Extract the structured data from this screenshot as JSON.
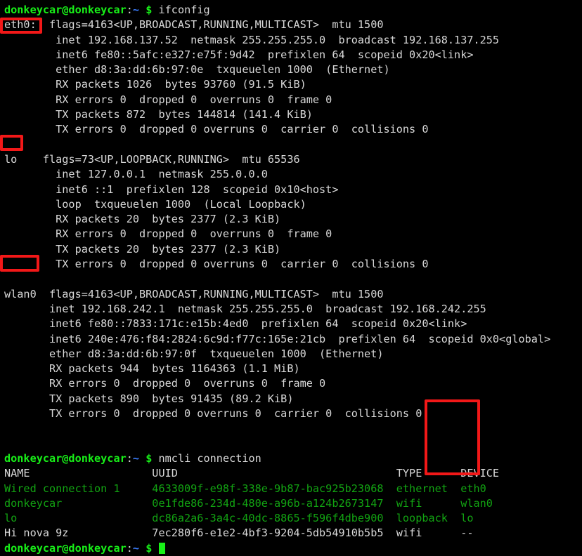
{
  "terminal": {
    "title": "donkeycar terminal",
    "background_color": "#000000",
    "foreground_color": "#d8d8d8",
    "prompt_color": "#18f018",
    "path_color": "#3b7dff",
    "table_color": "#12a312",
    "highlight_color": "#f21818",
    "prompt": {
      "user_host": "donkeycar@donkeycar",
      "colon": ":",
      "path": "~",
      "sigil": "$"
    },
    "commands": {
      "first": "ifconfig",
      "second": "nmcli connection"
    }
  },
  "ifconfig": {
    "interfaces": [
      {
        "name": "eth0:",
        "highlighted": true,
        "lines": [
          "flags=4163<UP,BROADCAST,RUNNING,MULTICAST>  mtu 1500",
          "inet 192.168.137.52  netmask 255.255.255.0  broadcast 192.168.137.255",
          "inet6 fe80::5afc:e327:e75f:9d42  prefixlen 64  scopeid 0x20<link>",
          "ether d8:3a:dd:6b:97:0e  txqueuelen 1000  (Ethernet)",
          "RX packets 1026  bytes 93760 (91.5 KiB)",
          "RX errors 0  dropped 0  overruns 0  frame 0",
          "TX packets 872  bytes 144814 (141.4 KiB)",
          "TX errors 0  dropped 0 overruns 0  carrier 0  collisions 0"
        ]
      },
      {
        "name": "lo",
        "highlighted": true,
        "lines": [
          "flags=73<UP,LOOPBACK,RUNNING>  mtu 65536",
          "inet 127.0.0.1  netmask 255.0.0.0",
          "inet6 ::1  prefixlen 128  scopeid 0x10<host>",
          "loop  txqueuelen 1000  (Local Loopback)",
          "RX packets 20  bytes 2377 (2.3 KiB)",
          "RX errors 0  dropped 0  overruns 0  frame 0",
          "TX packets 20  bytes 2377 (2.3 KiB)",
          "TX errors 0  dropped 0 overruns 0  carrier 0  collisions 0"
        ]
      },
      {
        "name": "wlan0",
        "highlighted": true,
        "lines": [
          "flags=4163<UP,BROADCAST,RUNNING,MULTICAST>  mtu 1500",
          "inet 192.168.242.1  netmask 255.255.255.0  broadcast 192.168.242.255",
          "inet6 fe80::7833:171c:e15b:4ed0  prefixlen 64  scopeid 0x20<link>",
          "inet6 240e:476:f84:2824:6c9d:f77c:165e:21cb  prefixlen 64  scopeid 0x0<global>",
          "ether d8:3a:dd:6b:97:0f  txqueuelen 1000  (Ethernet)",
          "RX packets 944  bytes 1164363 (1.1 MiB)",
          "RX errors 0  dropped 0  overruns 0  frame 0",
          "TX packets 890  bytes 91435 (89.2 KiB)",
          "TX errors 0  dropped 0 overruns 0  carrier 0  collisions 0"
        ]
      }
    ],
    "lines_flat": {
      "eth0_0": "eth0:",
      "eth0_0_rest": "  flags=4163<UP,BROADCAST,RUNNING,MULTICAST>  mtu 1500",
      "eth0_1": "        inet 192.168.137.52  netmask 255.255.255.0  broadcast 192.168.137.255",
      "eth0_2": "        inet6 fe80::5afc:e327:e75f:9d42  prefixlen 64  scopeid 0x20<link>",
      "eth0_3": "        ether d8:3a:dd:6b:97:0e  txqueuelen 1000  (Ethernet)",
      "eth0_4": "        RX packets 1026  bytes 93760 (91.5 KiB)",
      "eth0_5": "        RX errors 0  dropped 0  overruns 0  frame 0",
      "eth0_6": "        TX packets 872  bytes 144814 (141.4 KiB)",
      "eth0_7": "        TX errors 0  dropped 0 overruns 0  carrier 0  collisions 0",
      "lo_0": "lo",
      "lo_0_rest": "    flags=73<UP,LOOPBACK,RUNNING>  mtu 65536",
      "lo_1": "        inet 127.0.0.1  netmask 255.0.0.0",
      "lo_2": "        inet6 ::1  prefixlen 128  scopeid 0x10<host>",
      "lo_3": "        loop  txqueuelen 1000  (Local Loopback)",
      "lo_4": "        RX packets 20  bytes 2377 (2.3 KiB)",
      "lo_5": "        RX errors 0  dropped 0  overruns 0  frame 0",
      "lo_6": "        TX packets 20  bytes 2377 (2.3 KiB)",
      "lo_7": "        TX errors 0  dropped 0 overruns 0  carrier 0  collisions 0",
      "wlan0_0": "wlan0",
      "wlan0_0_rest": "  flags=4163<UP,BROADCAST,RUNNING,MULTICAST>  mtu 1500",
      "wlan0_1": "       inet 192.168.242.1  netmask 255.255.255.0  broadcast 192.168.242.255",
      "wlan0_2": "       inet6 fe80::7833:171c:e15b:4ed0  prefixlen 64  scopeid 0x20<link>",
      "wlan0_3": "       inet6 240e:476:f84:2824:6c9d:f77c:165e:21cb  prefixlen 64  scopeid 0x0<global>",
      "wlan0_4": "       ether d8:3a:dd:6b:97:0f  txqueuelen 1000  (Ethernet)",
      "wlan0_5": "       RX packets 944  bytes 1164363 (1.1 MiB)",
      "wlan0_6": "       RX errors 0  dropped 0  overruns 0  frame 0",
      "wlan0_7": "       TX packets 890  bytes 91435 (89.2 KiB)",
      "wlan0_8": "       TX errors 0  dropped 0 overruns 0  carrier 0  collisions 0"
    }
  },
  "nmcli": {
    "headers": {
      "name": "NAME",
      "uuid": "UUID",
      "type": "TYPE",
      "device": "DEVICE"
    },
    "header_line": "NAME                   UUID                                  TYPE      DEVICE",
    "rows": [
      {
        "name": "Wired connection 1",
        "uuid": "4633009f-e98f-338e-9b87-bac925b23068",
        "type": "ethernet",
        "device": "eth0",
        "color": "green",
        "line": "Wired connection 1     4633009f-e98f-338e-9b87-bac925b23068  ethernet  eth0"
      },
      {
        "name": "donkeycar",
        "uuid": "0e1fde86-234d-480e-a96b-a124b2673147",
        "type": "wifi",
        "device": "wlan0",
        "color": "green",
        "line": "donkeycar              0e1fde86-234d-480e-a96b-a124b2673147  wifi      wlan0"
      },
      {
        "name": "lo",
        "uuid": "dc86a2a6-3a4c-40dc-8865-f596f4dbe900",
        "type": "loopback",
        "device": "lo",
        "color": "green",
        "line": "lo                     dc86a2a6-3a4c-40dc-8865-f596f4dbe900  loopback  lo"
      },
      {
        "name": "Hi nova 9z",
        "uuid": "7ec280f6-e1e2-4bf3-9204-5db54910b5b5",
        "type": "wifi",
        "device": "--",
        "color": "white",
        "line": "Hi nova 9z             7ec280f6-e1e2-4bf3-9204-5db54910b5b5  wifi      --"
      }
    ]
  },
  "annotations": [
    {
      "name": "eth0-highlight",
      "label": "eth0:"
    },
    {
      "name": "lo-highlight",
      "label": "lo"
    },
    {
      "name": "wlan0-highlight",
      "label": "wlan0"
    },
    {
      "name": "device-column-highlight",
      "label": "DEVICE"
    }
  ]
}
